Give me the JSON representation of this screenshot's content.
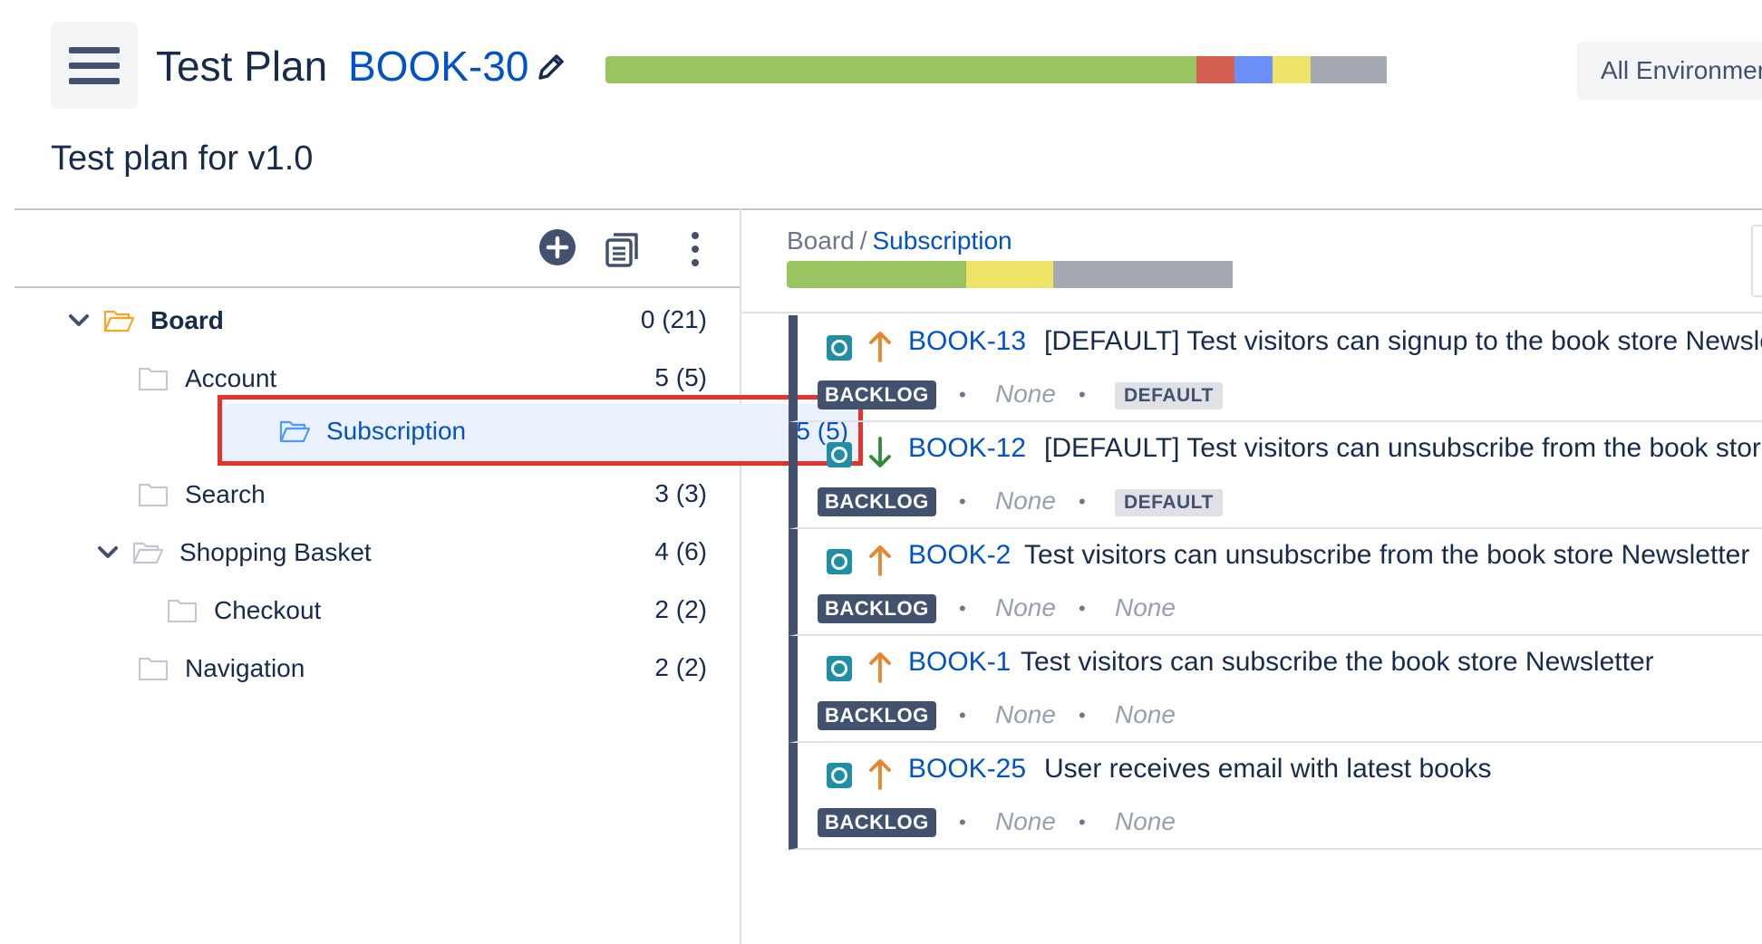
{
  "colors": {
    "progress_pass": "#99c461",
    "progress_fail": "#d25f52",
    "progress_executing": "#6b8ef7",
    "progress_todo": "#f0e36a",
    "progress_none": "#a5a9b2",
    "brand_blue": "#0052cc",
    "highlight_red": "#e5322b"
  },
  "header": {
    "menu_icon": "hamburger-icon",
    "title_prefix": "Test Plan",
    "plan_key": "BOOK-30",
    "edit_icon": "pencil-icon",
    "environment_button": "All Environmen",
    "subtitle": "Test plan for v1.0"
  },
  "plan_progress": [
    {
      "status": "pass",
      "fraction": 0.62
    },
    {
      "status": "fail",
      "fraction": 0.04
    },
    {
      "status": "executing",
      "fraction": 0.04
    },
    {
      "status": "todo",
      "fraction": 0.04
    },
    {
      "status": "none",
      "fraction": 0.08
    }
  ],
  "tree_toolbar": {
    "add_icon": "plus-circle-icon",
    "doc_icon": "documents-icon",
    "more_icon": "more-vertical-icon"
  },
  "tree": [
    {
      "label": "Board",
      "count": "0 (21)",
      "expanded": true
    },
    {
      "label": "Account",
      "count": "5 (5)"
    },
    {
      "label": "Subscription",
      "count": "5 (5)",
      "selected": true
    },
    {
      "label": "Search",
      "count": "3 (3)"
    },
    {
      "label": "Shopping Basket",
      "count": "4 (6)",
      "expanded": true
    },
    {
      "label": "Checkout",
      "count": "2 (2)"
    },
    {
      "label": "Navigation",
      "count": "2 (2)"
    }
  ],
  "breadcrumb": {
    "root": "Board",
    "separator": "/",
    "current": "Subscription"
  },
  "folder_progress": [
    {
      "status": "pass",
      "fraction": 0.33
    },
    {
      "status": "todo",
      "fraction": 0.16
    },
    {
      "status": "none",
      "fraction": 0.33
    }
  ],
  "tests": [
    {
      "key": "BOOK-13",
      "summary": "[DEFAULT] Test visitors can signup to the book store Newslett",
      "priority": "up",
      "status": "BACKLOG",
      "field1": "None",
      "field2": "DEFAULT",
      "field2_is_label": true
    },
    {
      "key": "BOOK-12",
      "summary": "[DEFAULT] Test visitors can unsubscribe from the book store N",
      "priority": "down",
      "status": "BACKLOG",
      "field1": "None",
      "field2": "DEFAULT",
      "field2_is_label": true
    },
    {
      "key": "BOOK-2",
      "summary": "Test visitors can unsubscribe from the book store Newsletter",
      "priority": "up",
      "status": "BACKLOG",
      "field1": "None",
      "field2": "None",
      "field2_is_label": false
    },
    {
      "key": "BOOK-1",
      "summary": "Test visitors can subscribe the book store Newsletter",
      "priority": "up",
      "status": "BACKLOG",
      "field1": "None",
      "field2": "None",
      "field2_is_label": false
    },
    {
      "key": "BOOK-25",
      "summary": "User receives email with latest books",
      "priority": "up",
      "status": "BACKLOG",
      "field1": "None",
      "field2": "None",
      "field2_is_label": false
    }
  ]
}
